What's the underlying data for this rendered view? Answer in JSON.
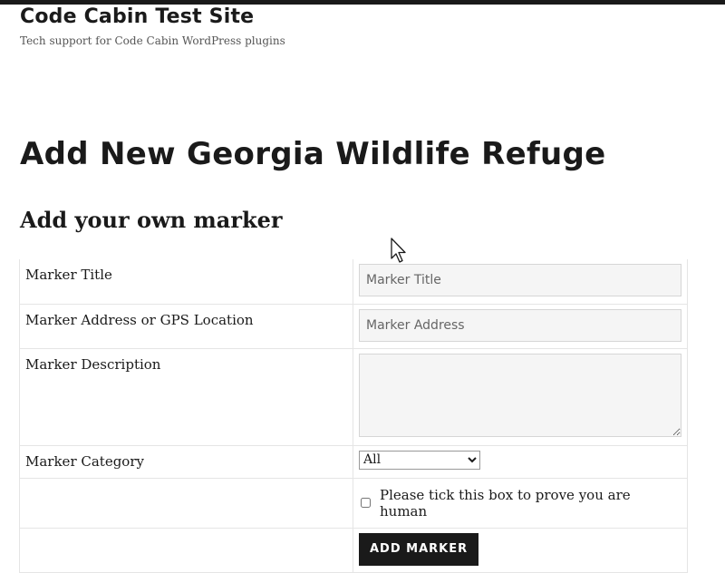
{
  "site": {
    "title": "Code Cabin Test Site",
    "tagline": "Tech support for Code Cabin WordPress plugins"
  },
  "page": {
    "title": "Add New Georgia Wildlife Refuge",
    "section_title": "Add your own marker"
  },
  "form": {
    "rows": [
      {
        "label": "Marker Title",
        "placeholder": "Marker Title"
      },
      {
        "label": "Marker Address or GPS Location",
        "placeholder": "Marker Address"
      },
      {
        "label": "Marker Description",
        "placeholder": ""
      },
      {
        "label": "Marker Category",
        "selected": "All"
      }
    ],
    "human_check_label": "Please tick this box to prove you are human",
    "submit_label": "ADD MARKER"
  }
}
